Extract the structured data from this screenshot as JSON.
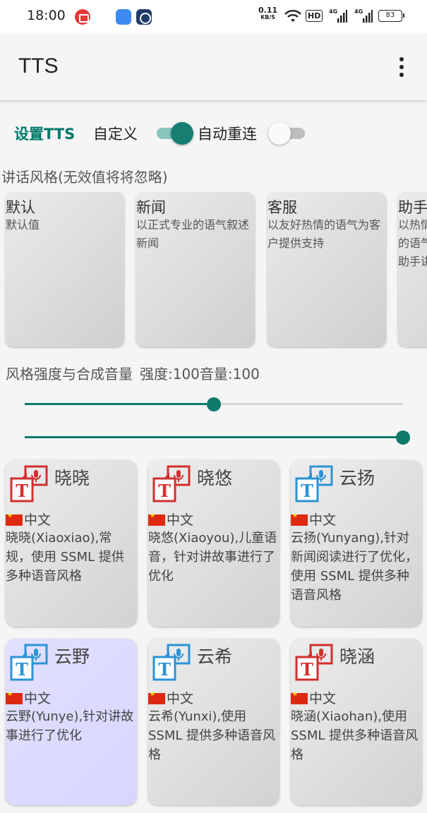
{
  "status_bar": {
    "time": "18:00",
    "speed_value": "0.11",
    "speed_unit": "KB/S",
    "hd": "HD",
    "sig1": "4G",
    "sig2": "4G",
    "battery": "83",
    "icons": [
      "screen-record-icon",
      "app-notification-icon",
      "app-notification-icon-2",
      "wifi-icon",
      "signal-icon",
      "battery-icon"
    ]
  },
  "app_bar": {
    "title": "TTS",
    "menu_icon": "more-vert-icon"
  },
  "controls": {
    "set_tts_label": "设置TTS",
    "custom_label": "自定义",
    "custom_on": true,
    "auto_reconnect_label": "自动重连",
    "auto_reconnect_on": false,
    "accent_color": "#00796b"
  },
  "style_section": {
    "label": "讲话风格(无效值将将忽略)",
    "styles": [
      {
        "name": "默认",
        "desc": "默认值"
      },
      {
        "name": "新闻",
        "desc": "以正式专业的语气叙述新闻"
      },
      {
        "name": "客服",
        "desc": "以友好热情的语气为客户提供支持"
      },
      {
        "name": "助手",
        "desc": "以热情而轻松的语气对数字助手讲话"
      }
    ]
  },
  "strength": {
    "label": "风格强度与合成音量",
    "values_label": "强度:100音量:100",
    "strength_fraction": 0.5,
    "volume_fraction": 1.0
  },
  "voices": [
    {
      "name": "晓晓",
      "lang": "中文",
      "desc": "晓晓(Xiaoxiao),常规，使用 SSML 提供多种语音风格",
      "icon_color": "#d32f2f",
      "selected": false
    },
    {
      "name": "晓悠",
      "lang": "中文",
      "desc": "晓悠(Xiaoyou),儿童语音，针对讲故事进行了优化",
      "icon_color": "#d32f2f",
      "selected": false
    },
    {
      "name": "云扬",
      "lang": "中文",
      "desc": "云扬(Yunyang),针对新闻阅读进行了优化，使用 SSML 提供多种语音风格",
      "icon_color": "#2b93d6",
      "selected": false
    },
    {
      "name": "云野",
      "lang": "中文",
      "desc": "云野(Yunye),针对讲故事进行了优化",
      "icon_color": "#2b93d6",
      "selected": true
    },
    {
      "name": "云希",
      "lang": "中文",
      "desc": "云希(Yunxi),使用 SSML 提供多种语音风格",
      "icon_color": "#2b93d6",
      "selected": false
    },
    {
      "name": "晓涵",
      "lang": "中文",
      "desc": "晓涵(Xiaohan),使用 SSML 提供多种语音风格",
      "icon_color": "#d32f2f",
      "selected": false
    }
  ]
}
